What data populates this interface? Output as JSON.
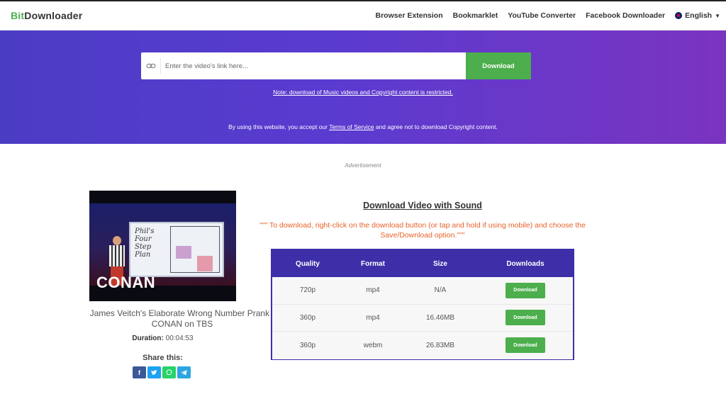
{
  "header": {
    "logo_bit": "Bit",
    "logo_rest": "Downloader",
    "nav": [
      "Browser Extension",
      "Bookmarklet",
      "YouTube Converter",
      "Facebook Downloader"
    ],
    "language": "English"
  },
  "hero": {
    "search_placeholder": "Enter the video's link here...",
    "download_label": "Download",
    "note": "Note: download of Music videos and Copyright content is restricted.",
    "tos_prefix": "By using this website, you accept our ",
    "tos_link": "Terms of Service",
    "tos_suffix": " and agree not to download Copyright content."
  },
  "ad_label": "Advertisement",
  "video": {
    "thumb_board_text": "Phil's Four Step Plan",
    "thumb_logo": "CONAN",
    "title": "James Veitch's Elaborate Wrong Number Prank - CONAN on TBS",
    "duration_label": "Duration:",
    "duration_value": "00:04:53",
    "share_label": "Share this:",
    "share_icons": [
      "facebook-icon",
      "twitter-icon",
      "whatsapp-icon",
      "telegram-icon"
    ]
  },
  "downloads": {
    "heading": "Download Video with Sound",
    "instructions": "\"\"\" To download, right-click on the download button (or tap and hold if using mobile) and choose the Save/Download option.\"\"\"",
    "columns": [
      "Quality",
      "Format",
      "Size",
      "Downloads"
    ],
    "rows": [
      {
        "quality": "720p",
        "format": "mp4",
        "size": "N/A",
        "button": "Download"
      },
      {
        "quality": "360p",
        "format": "mp4",
        "size": "16.46MB",
        "button": "Download"
      },
      {
        "quality": "360p",
        "format": "webm",
        "size": "26.83MB",
        "button": "Download"
      }
    ]
  },
  "colors": {
    "accent_green": "#4cae4c",
    "hero_start": "#4b3cc4",
    "hero_end": "#7a34c0",
    "table_header": "#3d2fa8",
    "instructions": "#e8622a"
  }
}
